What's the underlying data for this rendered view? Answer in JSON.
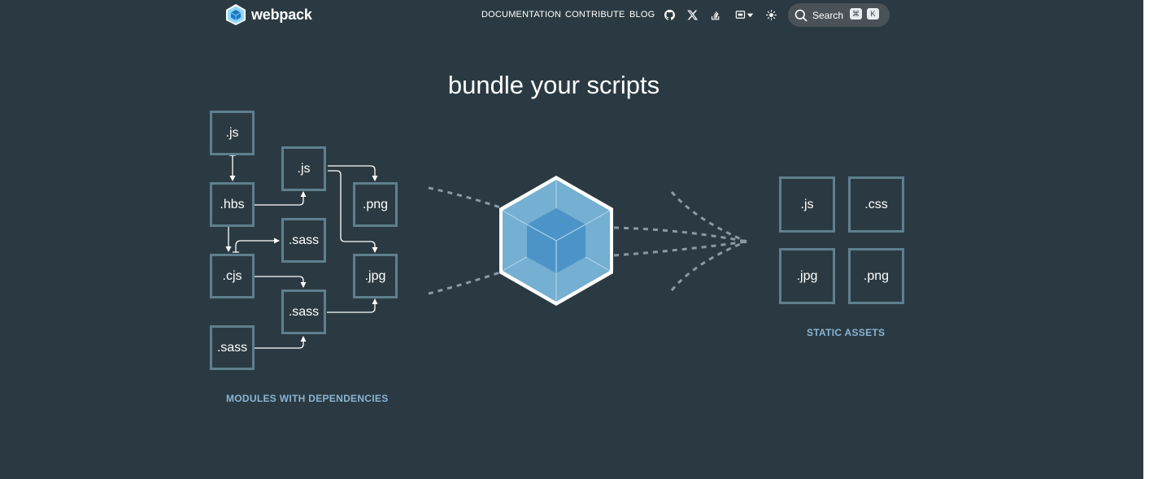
{
  "header": {
    "logo_text": "webpack",
    "nav": {
      "documentation": "DOCUMENTATION",
      "contribute": "CONTRIBUTE",
      "blog": "BLOG"
    },
    "search": {
      "label": "Search",
      "shortcut_mod": "⌘",
      "shortcut_key": "K"
    }
  },
  "hero": {
    "title": "bundle your scripts",
    "modules": {
      "caption": "MODULES WITH DEPENDENCIES",
      "items": [
        ".js",
        ".hbs",
        ".cjs",
        ".sass",
        ".js",
        ".sass",
        ".sass",
        ".png",
        ".jpg"
      ]
    },
    "assets": {
      "caption": "STATIC ASSETS",
      "items": [
        ".js",
        ".css",
        ".jpg",
        ".png"
      ]
    }
  },
  "colors": {
    "background": "#2b3a42",
    "box_border": "#5e7f8e",
    "caption": "#8ab4d4",
    "cube_light": "#8ed6fb",
    "cube_dark": "#1c78c0"
  }
}
